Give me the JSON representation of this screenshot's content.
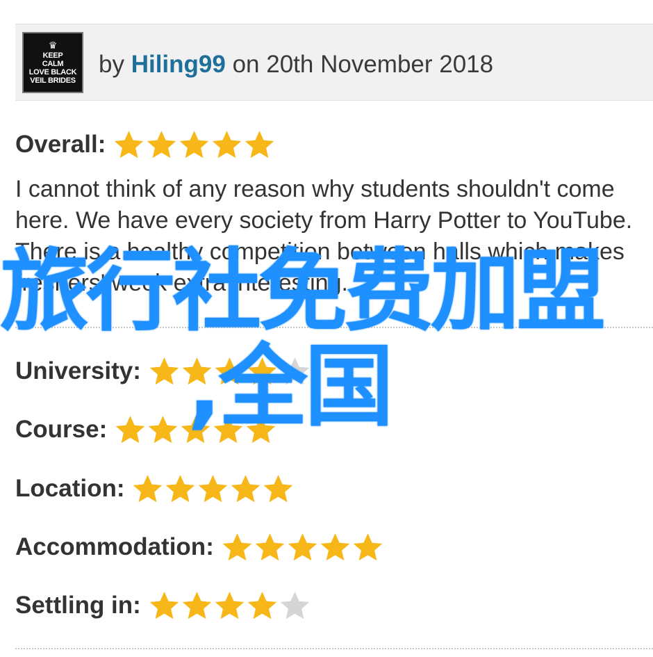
{
  "header": {
    "avatar_lines": [
      "KEEP",
      "CALM",
      "LOVE BLACK",
      "VEIL BRIDES"
    ],
    "by_prefix": "by",
    "username": "Hiling99",
    "date_text": "on 20th November 2018"
  },
  "overall": {
    "label": "Overall:",
    "stars": 5,
    "max": 5
  },
  "review_text": "I cannot think of any reason why students shouldn't come here. We have every society from Harry Potter to YouTube. There is a healthy competition between halls which makes freshers' week extra interesting.",
  "ratings": [
    {
      "label": "University:",
      "stars": 4,
      "max": 5
    },
    {
      "label": "Course:",
      "stars": 5,
      "max": 5
    },
    {
      "label": "Location:",
      "stars": 5,
      "max": 5
    },
    {
      "label": "Accommodation:",
      "stars": 5,
      "max": 5
    },
    {
      "label": "Settling in:",
      "stars": 4,
      "max": 5
    }
  ],
  "watermark": {
    "line1": "旅行社免费加盟",
    "line2": ",全国"
  },
  "colors": {
    "star_fill": "#f7b718",
    "star_empty": "#d5d5d5",
    "username": "#1e6f9a",
    "watermark": "#1e90ff"
  }
}
